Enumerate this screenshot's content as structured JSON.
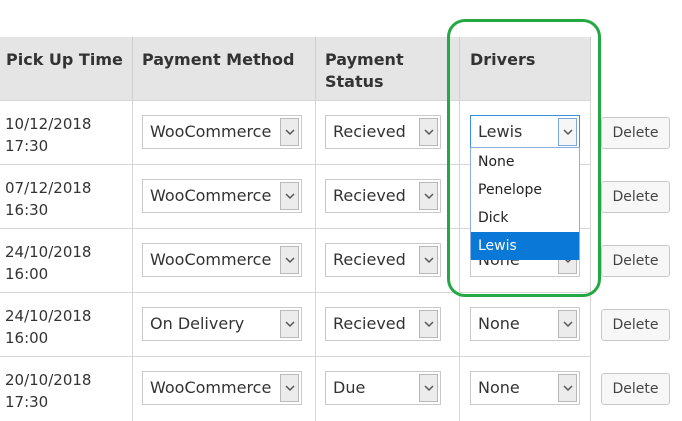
{
  "headers": {
    "pickup_time": "Pick Up Time",
    "payment_method": "Payment Method",
    "payment_status_line1": "Payment",
    "payment_status_line2": "Status",
    "drivers": "Drivers"
  },
  "rows": [
    {
      "date": "10/12/2018",
      "time": "17:30",
      "payment_method": "WooCommerce",
      "payment_status": "Recieved",
      "driver": "Lewis",
      "delete": "Delete"
    },
    {
      "date": "07/12/2018",
      "time": "16:30",
      "payment_method": "WooCommerce",
      "payment_status": "Recieved",
      "driver": "",
      "delete": "Delete"
    },
    {
      "date": "24/10/2018",
      "time": "16:00",
      "payment_method": "WooCommerce",
      "payment_status": "Recieved",
      "driver": "None",
      "delete": "Delete"
    },
    {
      "date": "24/10/2018",
      "time": "16:00",
      "payment_method": "On Delivery",
      "payment_status": "Recieved",
      "driver": "None",
      "delete": "Delete"
    },
    {
      "date": "20/10/2018",
      "time": "17:30",
      "payment_method": "WooCommerce",
      "payment_status": "Due",
      "driver": "None",
      "delete": "Delete"
    }
  ],
  "driver_dropdown": {
    "options": [
      "None",
      "Penelope",
      "Dick",
      "Lewis"
    ],
    "selected": "Lewis"
  },
  "colors": {
    "highlight": "#24a843",
    "selected_option": "#0a78d7",
    "header_bg": "#e5e5e5"
  }
}
